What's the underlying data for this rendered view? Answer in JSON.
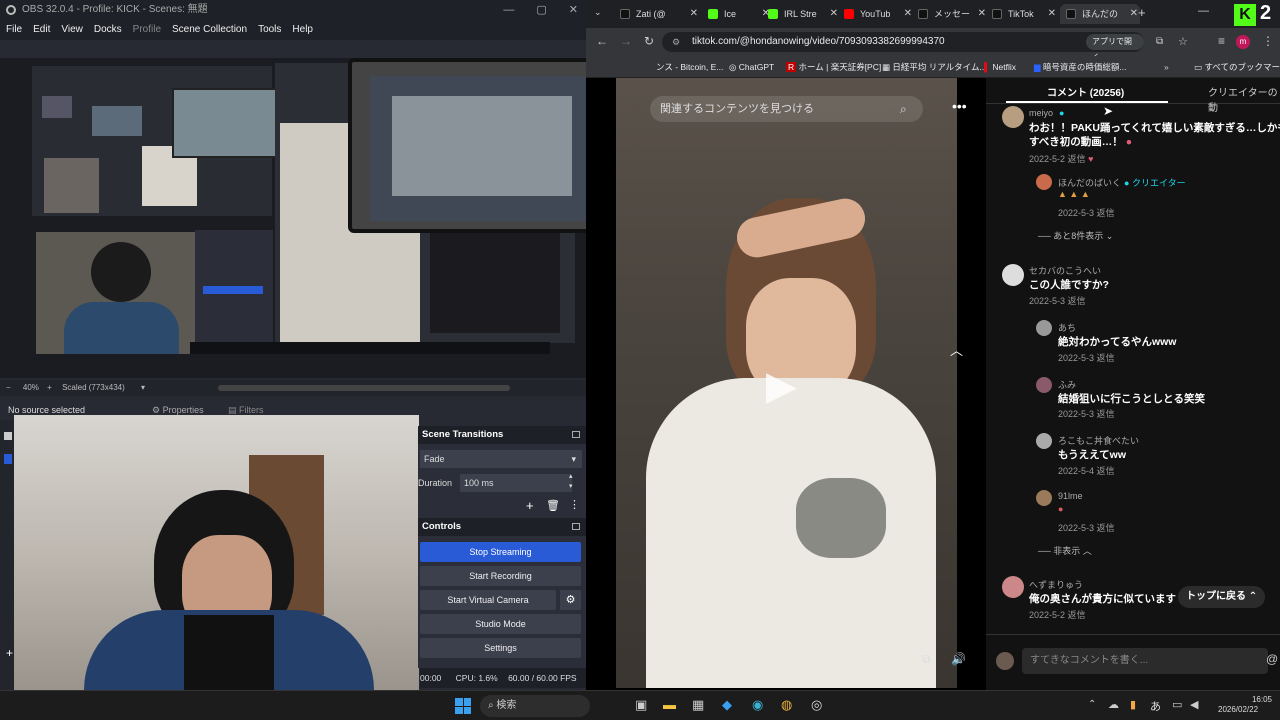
{
  "obs": {
    "title": "OBS 32.0.4 - Profile: KICK - Scenes: 無題",
    "menu": [
      "File",
      "Edit",
      "View",
      "Docks",
      "Profile",
      "Scene Collection",
      "Tools",
      "Help"
    ],
    "zoom": "40%",
    "scaled": "Scaled (773x434)",
    "no_source": "No source selected",
    "properties": "Properties",
    "filters": "Filters",
    "scene_transitions_title": "Scene Transitions",
    "transition": "Fade",
    "duration_label": "Duration",
    "duration_value": "100 ms",
    "controls_title": "Controls",
    "buttons": [
      "Stop Streaming",
      "Start Recording",
      "Start Virtual Camera",
      "Studio Mode",
      "Settings"
    ],
    "status_time": "00:00",
    "cpu": "CPU: 1.6%",
    "fps": "60.00 / 60.00 FPS"
  },
  "browser": {
    "tabs": [
      {
        "label": "Zati (@",
        "color": "#111"
      },
      {
        "label": "Ice",
        "color": "#53fc18"
      },
      {
        "label": "IRL Stre",
        "color": "#53fc18"
      },
      {
        "label": "YouTub",
        "color": "#ff0000"
      },
      {
        "label": "メッセー",
        "color": "#111"
      },
      {
        "label": "TikTok",
        "color": "#111"
      },
      {
        "label": "ほんだの",
        "color": "#111"
      }
    ],
    "url": "tiktok.com/@hondanowing/video/7093093382699994370",
    "open_in_app": "アプリで開く",
    "bookmarks": [
      "ンス - Bitcoin, E...",
      "ChatGPT",
      "ホーム | 楽天証券[PC]",
      "日経平均 リアルタイム...",
      "Netflix",
      "暗号資産の時価総額..."
    ],
    "all_bookmarks": "すべてのブックマーク"
  },
  "tiktok": {
    "search_placeholder": "関連するコンテンツを見つける",
    "comments_tab": "コメント (20256)",
    "creator_tab": "クリエイターの動",
    "comments": [
      {
        "name": "meiyo",
        "text": "わお！！PAKU踊ってくれて嬉しい素敵すぎる…しかも記",
        "text2": "すべき初の動画…！",
        "date": "2022-5-2",
        "reply": "返信"
      },
      {
        "name": "ほんだのばいく",
        "badge": "クリエイター",
        "text": "",
        "date": "2022-5-3",
        "reply": "返信"
      },
      {
        "more": "あと8件表示"
      },
      {
        "name": "セカバのこうへい",
        "text": "この人誰ですか?",
        "date": "2022-5-3",
        "reply": "返信"
      },
      {
        "name": "あち",
        "text": "絶対わかってるやんwww",
        "date": "2022-5-3",
        "reply": "返信"
      },
      {
        "name": "ふみ",
        "text": "結婚狙いに行こうとしとる笑笑",
        "date": "2022-5-3",
        "reply": "返信"
      },
      {
        "name": "ろこもこ丼食べたい",
        "text": "もうええてww",
        "date": "2022-5-4",
        "reply": "返信"
      },
      {
        "name": "91lme",
        "text": "",
        "date": "2022-5-3",
        "reply": "返信"
      },
      {
        "hide": "非表示"
      },
      {
        "name": "へずまりゅう",
        "text": "俺の奥さんが貴方に似ています",
        "date": "2022-5-2",
        "reply": "返信"
      }
    ],
    "back_to_top": "トップに戻る",
    "comment_placeholder": "すてきなコメントを書く..."
  },
  "taskbar": {
    "search": "検索",
    "ime": "あ",
    "time": "16:05",
    "date": "2026/02/22"
  },
  "kick_badge": "2"
}
